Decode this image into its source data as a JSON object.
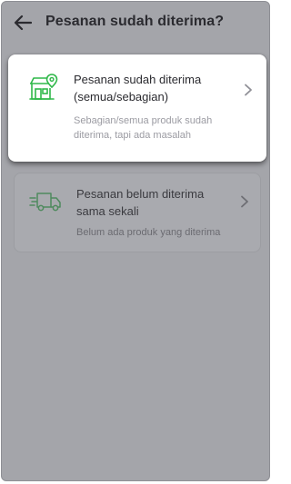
{
  "header": {
    "title": "Pesanan sudah diterima?",
    "back_icon": "arrow-left-icon"
  },
  "options": [
    {
      "title_line1": "Pesanan sudah diterima",
      "title_line2": "(semua/sebagian)",
      "desc_line1": "Sebagian/semua produk sudah",
      "desc_line2": "diterima, tapi ada masalah",
      "icon": "store-location-icon",
      "selected": true
    },
    {
      "title_line1": "Pesanan belum diterima",
      "title_line2": "sama sekali",
      "desc_line1": "Belum ada produk yang diterima",
      "icon": "delivery-truck-icon",
      "selected": false
    }
  ],
  "colors": {
    "accent": "#2fb849",
    "overlay": "#a4a5aa",
    "text": "#2b2b30"
  }
}
